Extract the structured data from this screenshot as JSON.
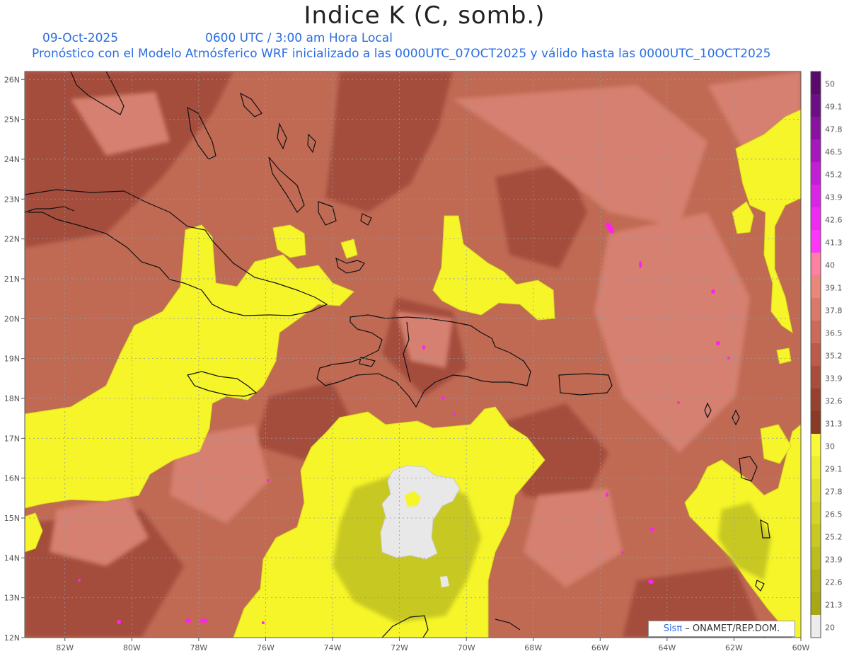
{
  "header": {
    "title": "Indice K (C, somb.)",
    "date": "09-Oct-2025",
    "time": "0600 UTC / 3:00 am Hora Local",
    "description": "Pronóstico con el Modelo Atmósferico WRF inicializado a las 0000UTC_07OCT2025 y válido hasta las  0000UTC_10OCT2025"
  },
  "map": {
    "lon_range": [
      -83.2,
      -60
    ],
    "lat_range": [
      12,
      26.2
    ],
    "lon_ticks": [
      "82W",
      "80W",
      "78W",
      "76W",
      "74W",
      "72W",
      "70W",
      "68W",
      "66W",
      "64W",
      "62W",
      "60W"
    ],
    "lat_ticks": [
      "12N",
      "13N",
      "14N",
      "15N",
      "16N",
      "17N",
      "18N",
      "19N",
      "20N",
      "21N",
      "22N",
      "23N",
      "24N",
      "25N",
      "26N"
    ],
    "colors": {
      "background": "#c06a54",
      "dark_band": "#a44d3c",
      "light_band": "#d58070",
      "yellow": "#f5f52a",
      "olive": "#c8c820",
      "grey": "#e8e8e8",
      "magenta": "#ff22ee",
      "coast": "#111111"
    }
  },
  "colorbar": {
    "labels": [
      "50",
      "49.1",
      "47.8",
      "46.5",
      "45.2",
      "43.9",
      "42.6",
      "41.3",
      "40",
      "39.1",
      "37.8",
      "36.5",
      "35.2",
      "33.9",
      "32.6",
      "31.3",
      "30",
      "29.1",
      "27.8",
      "26.5",
      "25.2",
      "23.9",
      "22.6",
      "21.3",
      "20"
    ],
    "colors": [
      "#5a0a6a",
      "#6e0e84",
      "#8a12a0",
      "#a418bc",
      "#c21ed6",
      "#dc24e8",
      "#f02af2",
      "#ff36fa",
      "#ff80a0",
      "#e8877a",
      "#d97968",
      "#cc6a58",
      "#bc5b48",
      "#aa4c3a",
      "#98402e",
      "#883a24",
      "#f8f836",
      "#ecec30",
      "#e0e02a",
      "#d4d426",
      "#c8c820",
      "#bcbc1c",
      "#b0b018",
      "#a8a814",
      "#ececec"
    ]
  },
  "credit": {
    "brand": "Sisπ",
    "text": " – ONAMET/REP.DOM."
  }
}
